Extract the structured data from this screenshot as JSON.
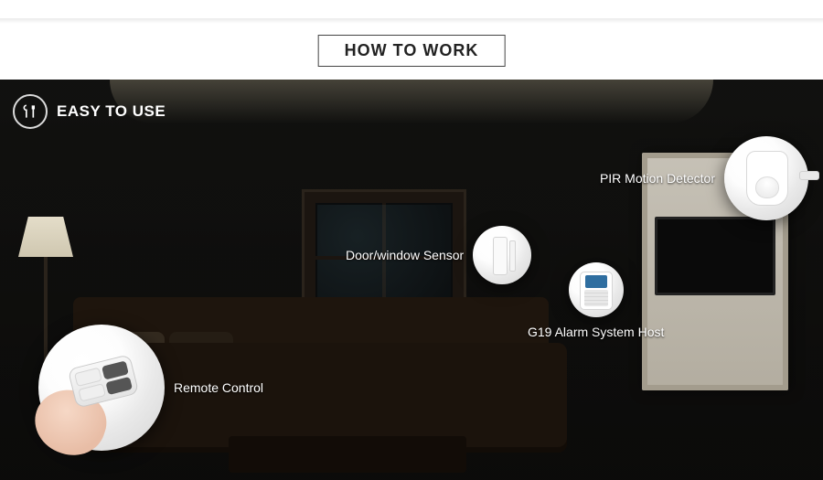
{
  "header": {
    "title": "HOW TO WORK"
  },
  "badge": {
    "label": "EASY TO USE",
    "icon": "tools-icon"
  },
  "callouts": {
    "pir": {
      "label": "PIR Motion Detector"
    },
    "dw": {
      "label": "Door/window Sensor"
    },
    "host": {
      "label": "G19 Alarm System Host"
    },
    "remote": {
      "label": "Remote Control"
    }
  }
}
